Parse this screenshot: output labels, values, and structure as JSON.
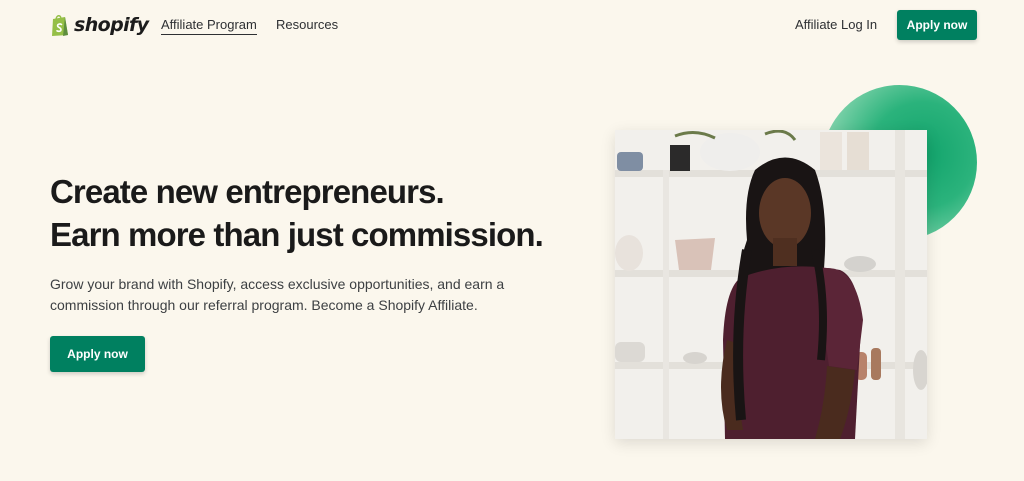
{
  "header": {
    "logo_text": "shopify",
    "nav": {
      "affiliate_program": "Affiliate Program",
      "resources": "Resources",
      "affiliate_login": "Affiliate Log In"
    },
    "apply_label": "Apply now"
  },
  "hero": {
    "headline_line1": "Create new entrepreneurs.",
    "headline_line2": "Earn more than just commission.",
    "subtext": "Grow your brand with Shopify, access exclusive opportunities, and earn a commission through our referral program. Become a Shopify Affiliate.",
    "apply_label": "Apply now"
  },
  "colors": {
    "background": "#fbf7ed",
    "brand_green": "#008060",
    "logo_green": "#95bf47"
  },
  "icons": {
    "logo": "shopify-bag-icon"
  }
}
